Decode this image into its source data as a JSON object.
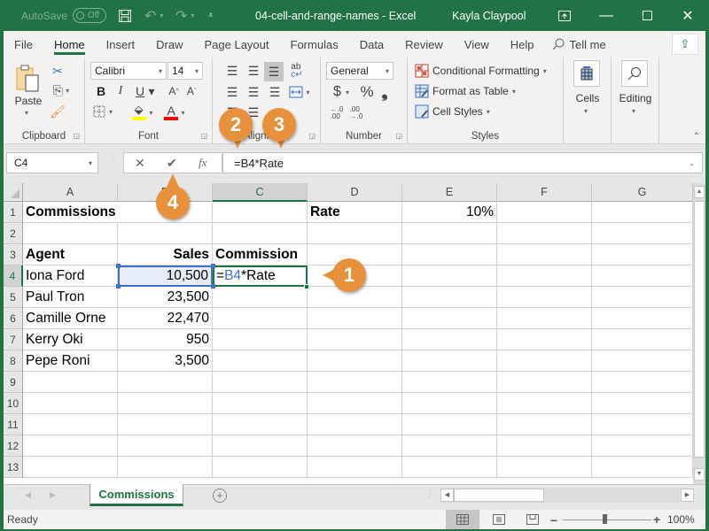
{
  "titlebar": {
    "autosave_label": "AutoSave",
    "autosave_state": "Off",
    "title": "04-cell-and-range-names  -  Excel",
    "user": "Kayla Claypool"
  },
  "tabs": [
    {
      "label": "File"
    },
    {
      "label": "Home",
      "active": true
    },
    {
      "label": "Insert"
    },
    {
      "label": "Draw"
    },
    {
      "label": "Page Layout"
    },
    {
      "label": "Formulas"
    },
    {
      "label": "Data"
    },
    {
      "label": "Review"
    },
    {
      "label": "View"
    },
    {
      "label": "Help"
    }
  ],
  "tell_me": "Tell me",
  "ribbon": {
    "clipboard": {
      "label": "Clipboard",
      "paste": "Paste"
    },
    "font": {
      "label": "Font",
      "font_name": "Calibri",
      "font_size": "14",
      "bold": "B",
      "italic": "I",
      "underline": "U",
      "fill_color": "#ffff00",
      "font_color": "#ff0000"
    },
    "alignment": {
      "label": "Alignment"
    },
    "number": {
      "label": "Number",
      "format": "General",
      "currency": "$",
      "percent": "%",
      "comma": "❟"
    },
    "styles": {
      "label": "Styles",
      "conditional_formatting": "Conditional Formatting",
      "format_as_table": "Format as Table",
      "cell_styles": "Cell Styles"
    },
    "cells": {
      "label": "Cells"
    },
    "editing": {
      "label": "Editing"
    }
  },
  "formula_bar": {
    "name_box": "C4",
    "cancel": "✕",
    "enter": "✔",
    "fx": "fx",
    "formula": "=B4*Rate"
  },
  "columns": [
    "A",
    "B",
    "C",
    "D",
    "E",
    "F",
    "G"
  ],
  "selected_column": "C",
  "rows": [
    "1",
    "2",
    "3",
    "4",
    "5",
    "6",
    "7",
    "8",
    "9",
    "10",
    "11",
    "12",
    "13"
  ],
  "selected_row": "4",
  "cells": {
    "A1": "Commissions",
    "D1": "Rate",
    "E1": "10%",
    "A3": "Agent",
    "B3": "Sales",
    "C3": "Commission",
    "A4": "Iona Ford",
    "B4": "10,500",
    "C4_ref": "B4",
    "C4_eq": "=",
    "C4_rest": "*Rate",
    "A5": "Paul Tron",
    "B5": "23,500",
    "A6": "Camille Orne",
    "B6": "22,470",
    "A7": "Kerry Oki",
    "B7": "950",
    "A8": "Pepe Roni",
    "B8": "3,500"
  },
  "sheet_tab": "Commissions",
  "status": {
    "ready": "Ready",
    "zoom": "100%"
  },
  "callouts": [
    "1",
    "2",
    "3",
    "4"
  ],
  "colors": {
    "brand": "#217346",
    "callout": "#e8913d",
    "ref_blue": "#4472c4"
  }
}
